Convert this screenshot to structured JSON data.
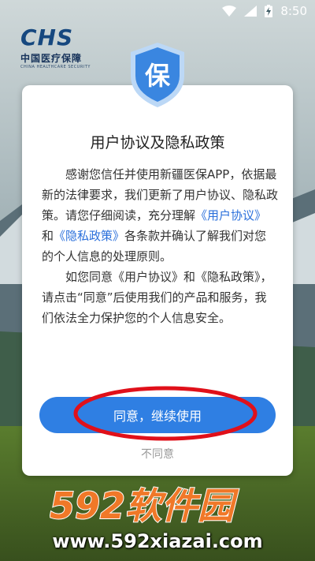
{
  "status_bar": {
    "time": "8:50",
    "icons": [
      "wifi-icon",
      "signal-icon",
      "battery-charging-icon"
    ]
  },
  "logo": {
    "mark": "CHS",
    "cn": "中国医疗保障",
    "en": "CHINA HEALTHCARE SECURITY"
  },
  "dialog": {
    "shield_char": "保",
    "title": "用户协议及隐私政策",
    "para1": {
      "a": "感谢您信任并使用新疆医保APP，依据最新的法律要求，我们更新了用户协议、隐私政策。请您仔细阅读，充分理解",
      "link1": "《用户协议》",
      "and": "和",
      "link2": "《隐私政策》",
      "b": "各条款并确认了解我们对您的个人信息的处理原则。"
    },
    "para2": "如您同意《用户协议》和《隐私政策》，请点击“同意”后使用我们的产品和服务，我们依法全力保护您的个人信息安全。",
    "agree_label": "同意，继续使用",
    "disagree_label": "不同意"
  },
  "watermark": {
    "brand": "592软件园",
    "url": "www.592xiazai.com"
  },
  "colors": {
    "accent": "#2f7fe3",
    "link": "#2a6fdb",
    "annotation": "#e0101a"
  }
}
